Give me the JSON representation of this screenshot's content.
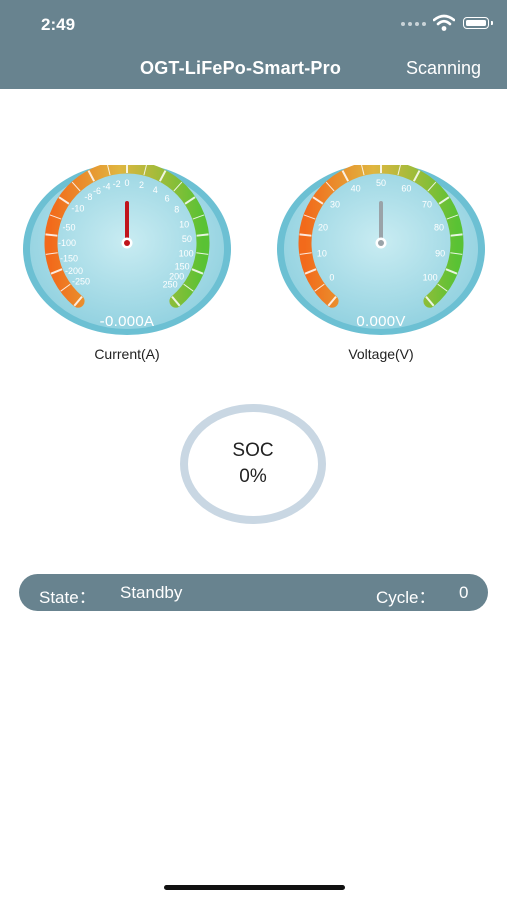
{
  "status_bar": {
    "time": "2:49"
  },
  "nav": {
    "title": "OGT-LiFePo-Smart-Pro",
    "action": "Scanning"
  },
  "current_gauge": {
    "label": "Current(A)",
    "reading": "-0.000A",
    "value": 0,
    "left_ticks": [
      "-2",
      "-4",
      "-6",
      "-8",
      "-10",
      "-50",
      "-100",
      "-150",
      "-200",
      "-250"
    ],
    "top_ticks": [
      "0",
      "2",
      "4",
      "6"
    ],
    "right_ticks": [
      "8",
      "10",
      "50",
      "100",
      "150",
      "200",
      "250"
    ]
  },
  "voltage_gauge": {
    "label": "Voltage(V)",
    "reading": "0.000V",
    "value": 0,
    "ticks": [
      "0",
      "10",
      "20",
      "30",
      "40",
      "50",
      "60",
      "70",
      "80",
      "90",
      "100"
    ]
  },
  "soc": {
    "label": "SOC",
    "value": "0%"
  },
  "state_bar": {
    "state_label": "State：",
    "state_value": "Standby",
    "cycle_label": "Cycle：",
    "cycle_value": "0"
  },
  "colors": {
    "header": "#68838f",
    "dial_face": "#a8dde7",
    "ring": "#c9d7e3",
    "needle_current": "#c0141b",
    "needle_voltage": "#9aa3a8"
  }
}
